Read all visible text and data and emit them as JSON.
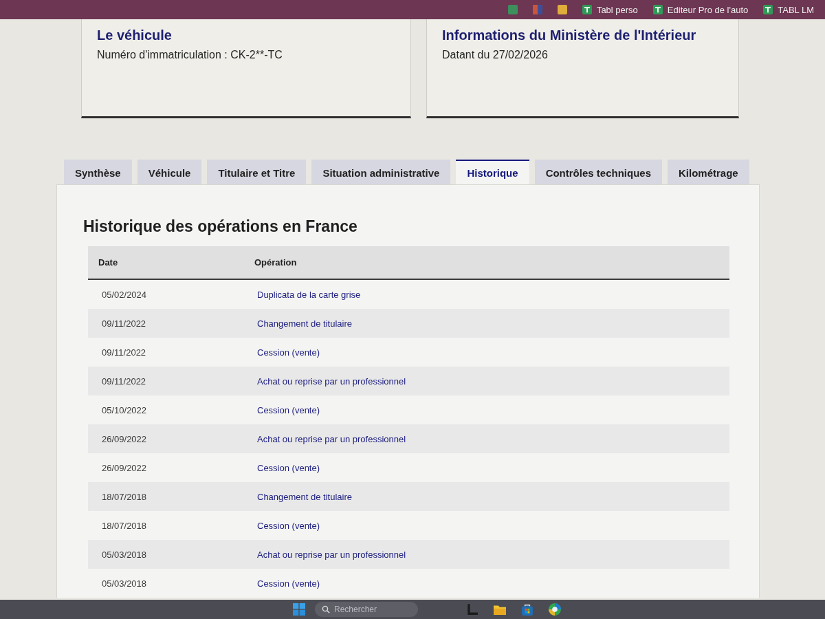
{
  "bookmarks_bar": {
    "items": [
      {
        "label": "Tabl perso"
      },
      {
        "label": "Editeur Pro de l'auto"
      },
      {
        "label": "TABL LM"
      }
    ]
  },
  "cards": [
    {
      "title": "Le véhicule",
      "lines": [
        "Numéro d'immatriculation : CK-2**-TC"
      ]
    },
    {
      "title": "Informations du Ministère de l'Intérieur",
      "lines": [
        "Datant du 27/02/2026"
      ]
    }
  ],
  "tabs": [
    {
      "label": "Synthèse",
      "selected": false
    },
    {
      "label": "Véhicule",
      "selected": false
    },
    {
      "label": "Titulaire et Titre",
      "selected": false
    },
    {
      "label": "Situation administrative",
      "selected": false
    },
    {
      "label": "Historique",
      "selected": true
    },
    {
      "label": "Contrôles techniques",
      "selected": false
    },
    {
      "label": "Kilométrage",
      "selected": false
    }
  ],
  "panel": {
    "title": "Historique des opérations en France",
    "table": {
      "columns": [
        "Date",
        "Opération"
      ],
      "rows": [
        {
          "date": "05/02/2024",
          "operation": "Duplicata de la carte grise"
        },
        {
          "date": "09/11/2022",
          "operation": "Changement de titulaire"
        },
        {
          "date": "09/11/2022",
          "operation": "Cession (vente)"
        },
        {
          "date": "09/11/2022",
          "operation": "Achat ou reprise par un professionnel"
        },
        {
          "date": "05/10/2022",
          "operation": "Cession (vente)"
        },
        {
          "date": "26/09/2022",
          "operation": "Achat ou reprise par un professionnel"
        },
        {
          "date": "26/09/2022",
          "operation": "Cession (vente)"
        },
        {
          "date": "18/07/2018",
          "operation": "Changement de titulaire"
        },
        {
          "date": "18/07/2018",
          "operation": "Cession (vente)"
        },
        {
          "date": "05/03/2018",
          "operation": "Achat ou reprise par un professionnel"
        },
        {
          "date": "05/03/2018",
          "operation": "Cession (vente)"
        }
      ]
    }
  },
  "taskbar": {
    "search": {
      "placeholder": "Rechercher"
    }
  }
}
